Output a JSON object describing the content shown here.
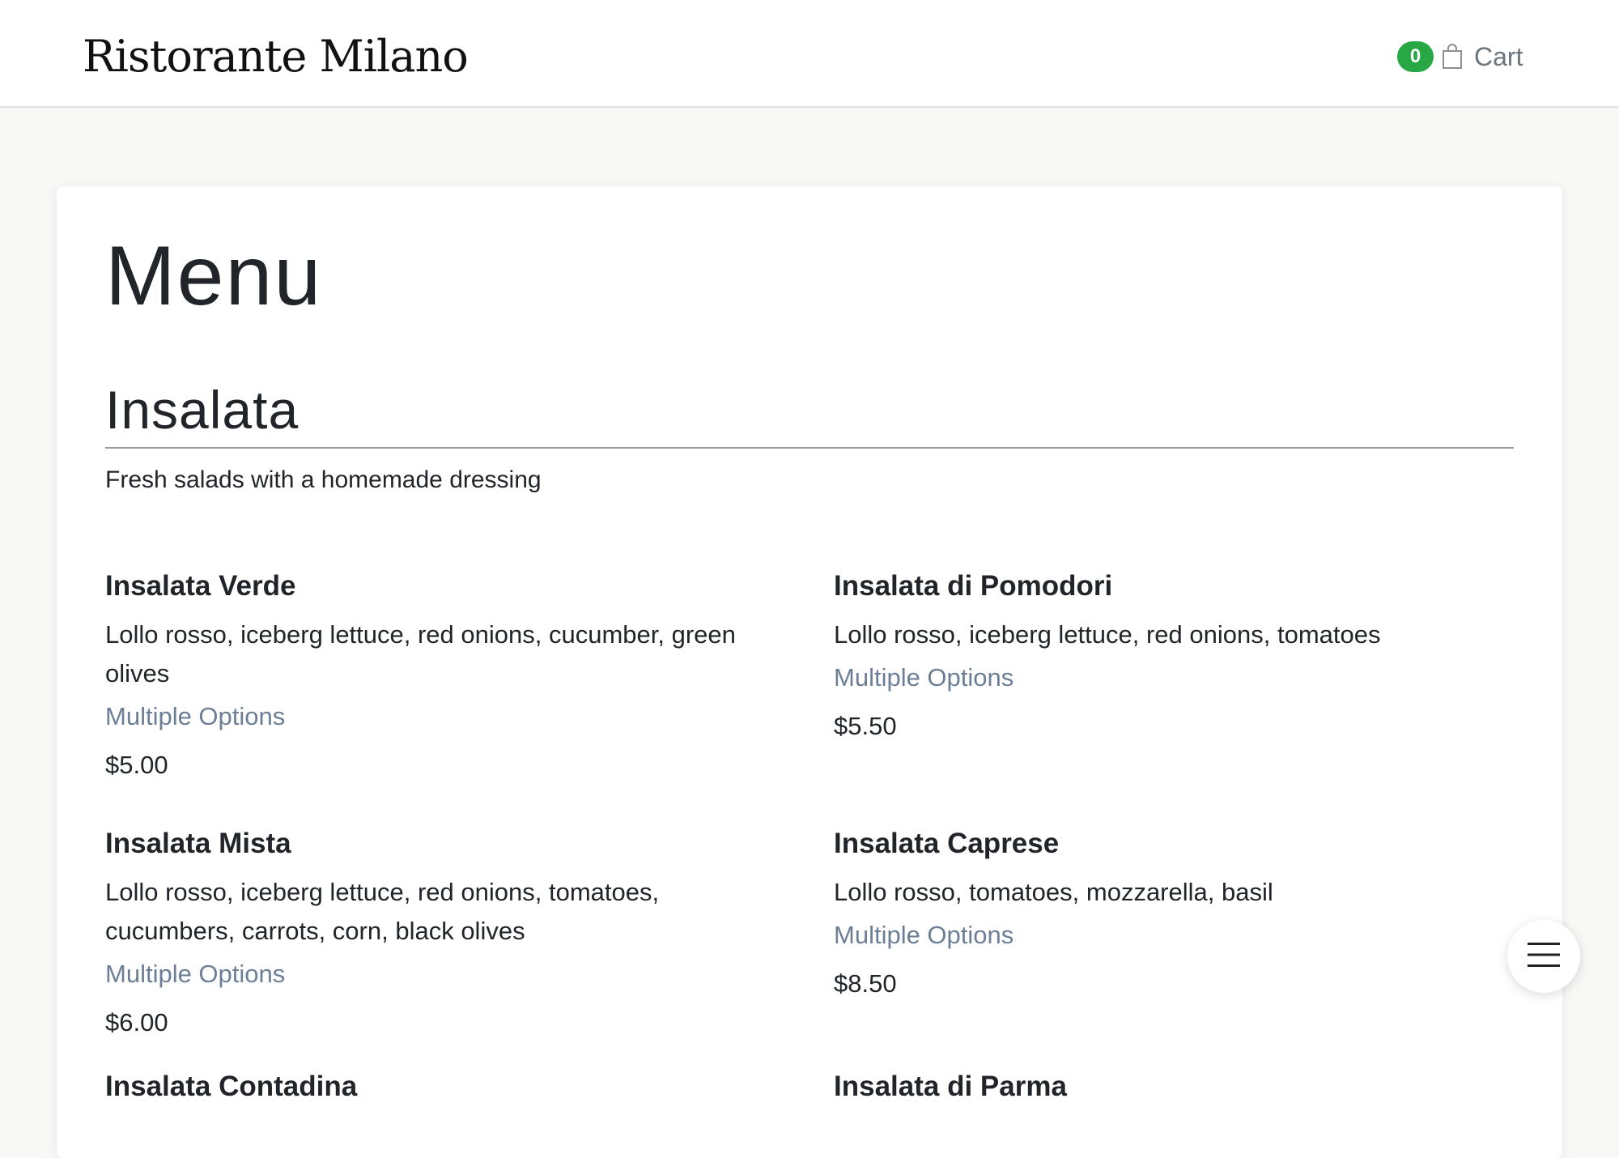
{
  "header": {
    "brand": "Ristorante Milano",
    "cart_count": "0",
    "cart_label": "Cart",
    "cart_icon": "shopping-bag-icon"
  },
  "main": {
    "title": "Menu",
    "section": {
      "title": "Insalata",
      "description": "Fresh salads with a homemade dressing",
      "items": [
        {
          "name": "Insalata Verde",
          "description": "Lollo rosso, iceberg lettuce, red onions, cucumber, green olives",
          "options_label": "Multiple Options",
          "price": "$5.00"
        },
        {
          "name": "Insalata di Pomodori",
          "description": "Lollo rosso, iceberg lettuce, red onions, tomatoes",
          "options_label": "Multiple Options",
          "price": "$5.50"
        },
        {
          "name": "Insalata Mista",
          "description": "Lollo rosso, iceberg lettuce, red onions, tomatoes, cucumbers, carrots, corn, black olives",
          "options_label": "Multiple Options",
          "price": "$6.00"
        },
        {
          "name": "Insalata Caprese",
          "description": "Lollo rosso, tomatoes, mozzarella, basil",
          "options_label": "Multiple Options",
          "price": "$8.50"
        },
        {
          "name": "Insalata Contadina"
        },
        {
          "name": "Insalata di Parma"
        }
      ]
    }
  },
  "fab": {
    "icon": "hamburger-menu-icon"
  },
  "colors": {
    "badge": "#28a745",
    "options_link": "#6c7f96",
    "page_background": "#f8f8f6"
  }
}
